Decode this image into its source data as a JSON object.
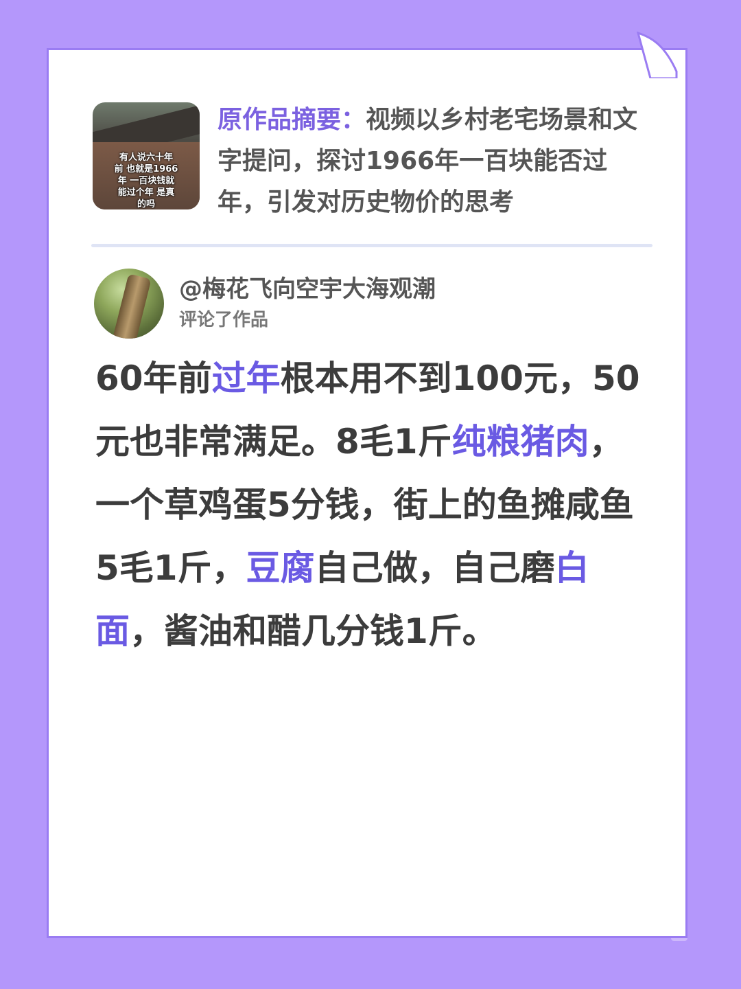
{
  "summary": {
    "label": "原作品摘要：",
    "text": "视频以乡村老宅场景和文字提问，探讨1966年一百块能否过年，引发对历史物价的思考",
    "thumbnail_caption": "有人说六十年\n前 也就是1966\n年 一百块钱就\n能过个年 是真\n的吗"
  },
  "comment_author": {
    "name": "@梅花飞向空宇大海观潮",
    "action": "评论了作品"
  },
  "comment": {
    "segments": [
      {
        "text": "60年前",
        "highlight": false
      },
      {
        "text": "过年",
        "highlight": true
      },
      {
        "text": "根本用不到100元，50元也非常满足。8毛1斤",
        "highlight": false
      },
      {
        "text": "纯粮猪肉",
        "highlight": true
      },
      {
        "text": "，一个草鸡蛋5分钱，街上的鱼摊咸鱼5毛1斤，",
        "highlight": false
      },
      {
        "text": "豆腐",
        "highlight": true
      },
      {
        "text": "自己做，自己磨",
        "highlight": false
      },
      {
        "text": "白面",
        "highlight": true
      },
      {
        "text": "，酱油和醋几分钱1斤。",
        "highlight": false
      }
    ]
  },
  "colors": {
    "background": "#b497fb",
    "card_border": "#9a7cf2",
    "highlight": "#6a5ae3",
    "summary_label": "#7b61e0",
    "text": "#3c3c3c"
  }
}
